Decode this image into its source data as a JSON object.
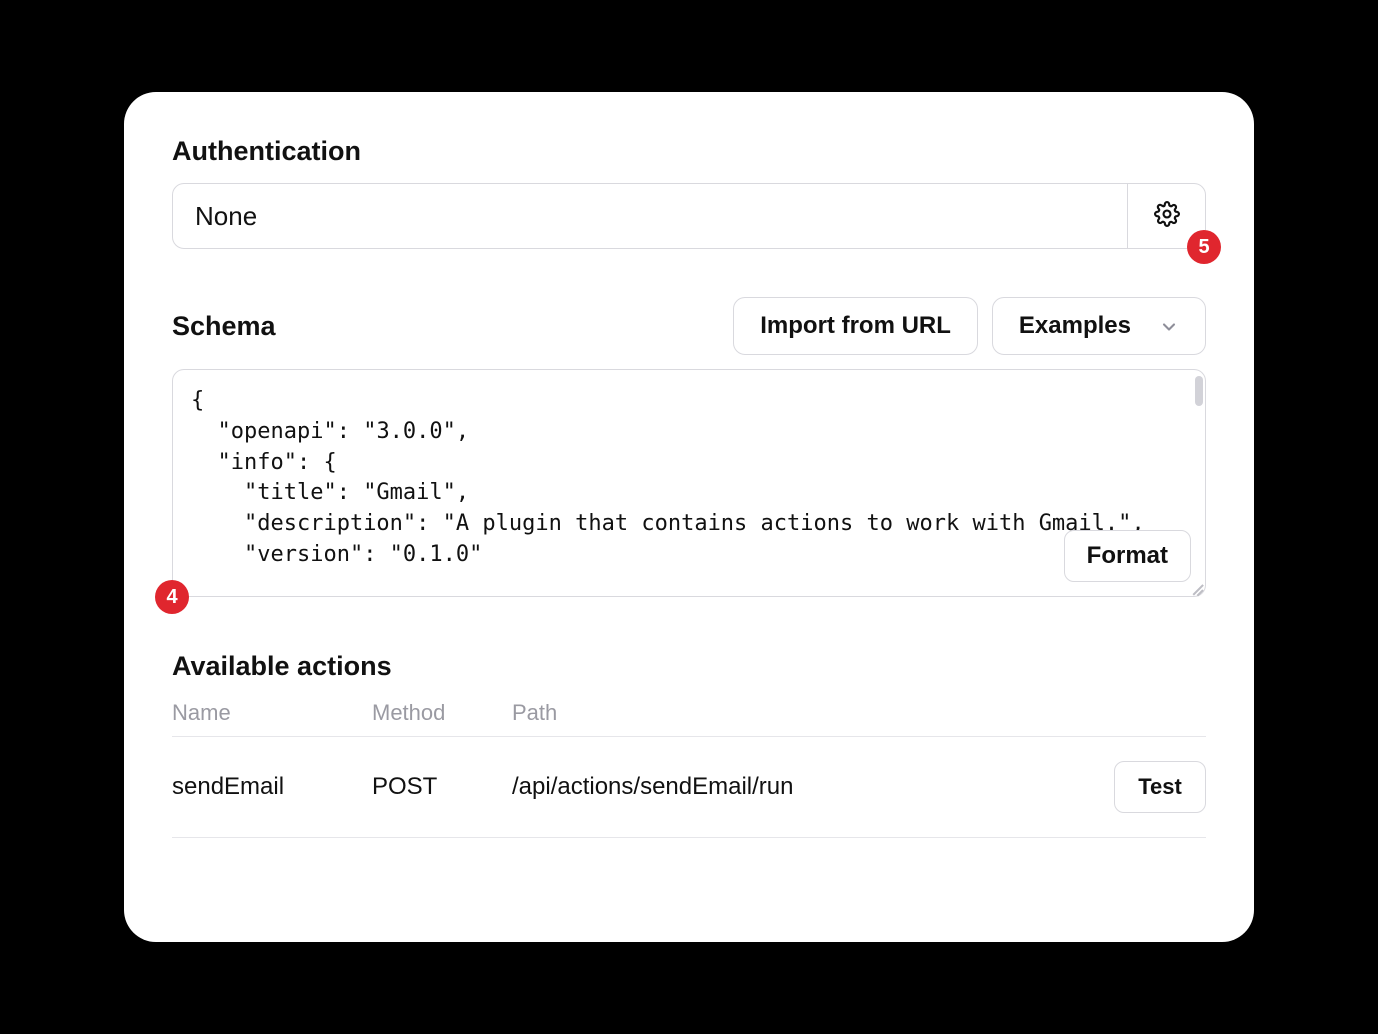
{
  "authentication": {
    "label": "Authentication",
    "value": "None",
    "gear_icon": "gear-icon"
  },
  "schema": {
    "label": "Schema",
    "import_button": "Import from URL",
    "examples_button": "Examples",
    "format_button": "Format",
    "content": "{\n  \"openapi\": \"3.0.0\",\n  \"info\": {\n    \"title\": \"Gmail\",\n    \"description\": \"A plugin that contains actions to work with Gmail.\",\n    \"version\": \"0.1.0\""
  },
  "actions": {
    "label": "Available actions",
    "columns": {
      "name": "Name",
      "method": "Method",
      "path": "Path"
    },
    "rows": [
      {
        "name": "sendEmail",
        "method": "POST",
        "path": "/api/actions/sendEmail/run",
        "test_label": "Test"
      }
    ]
  },
  "annotations": {
    "badge_4": "4",
    "badge_5": "5"
  }
}
